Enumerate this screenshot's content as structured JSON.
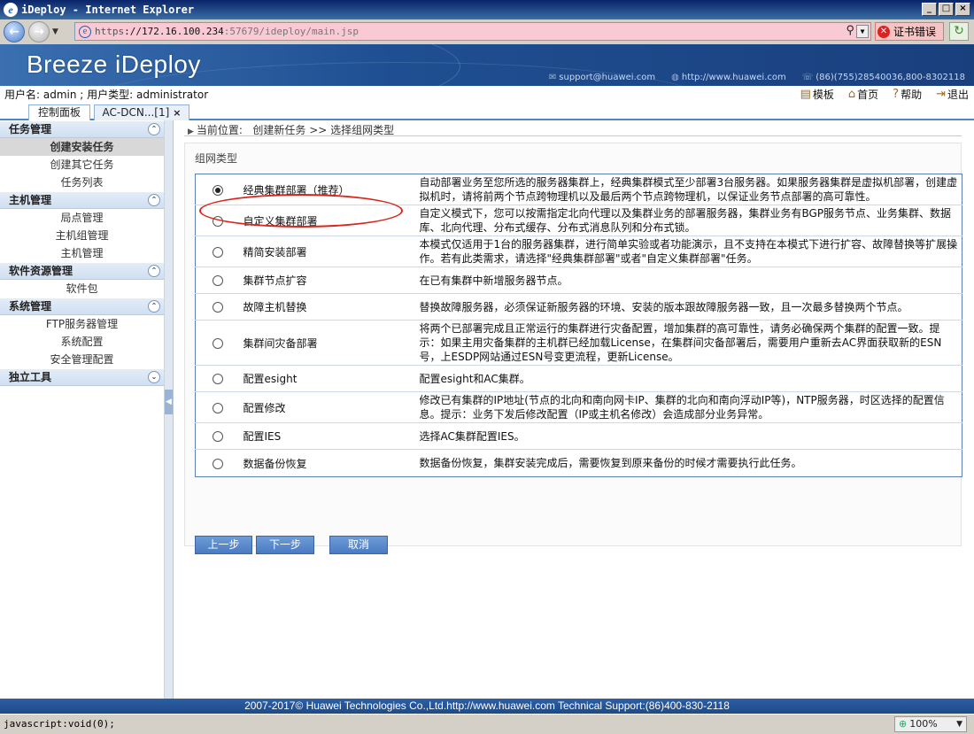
{
  "window": {
    "title": "iDeploy - Internet Explorer",
    "buttons": {
      "minimize": "_",
      "maximize": "□",
      "close": "×"
    }
  },
  "browser": {
    "url_scheme": "https",
    "url_host": "://172.16.100.234",
    "url_rest": ":57679/ideploy/main.jsp",
    "cert_error": "证书错误",
    "zoom": "100%",
    "status": "javascript:void(0);"
  },
  "banner": {
    "title": "Breeze iDeploy",
    "support": "support@huawei.com",
    "website": "http://www.huawei.com",
    "phone": "(86)(755)28540036,800-8302118"
  },
  "userbar": {
    "text": "用户名:  admin ;  用户类型:  administrator",
    "links": {
      "template": "模板",
      "home": "首页",
      "help": "帮助",
      "logout": "退出"
    }
  },
  "tabs": [
    {
      "label": "控制面板"
    },
    {
      "label": "AC-DCN...[1]"
    }
  ],
  "sidebar": {
    "sections": [
      {
        "title": "任务管理",
        "items": [
          "创建安装任务",
          "创建其它任务",
          "任务列表"
        ]
      },
      {
        "title": "主机管理",
        "items": [
          "局点管理",
          "主机组管理",
          "主机管理"
        ]
      },
      {
        "title": "软件资源管理",
        "items": [
          "软件包"
        ]
      },
      {
        "title": "系统管理",
        "items": [
          "FTP服务器管理",
          "系统配置",
          "安全管理配置"
        ]
      },
      {
        "title": "独立工具",
        "items": []
      }
    ],
    "active_item": "创建安装任务"
  },
  "main": {
    "breadcrumb_label": "当前位置:",
    "breadcrumb_path": "创建新任务 >> 选择组网类型",
    "panel_title": "组网类型",
    "options": [
      {
        "name": "经典集群部署（推荐）",
        "desc": "自动部署业务至您所选的服务器集群上，经典集群模式至少部署3台服务器。如果服务器集群是虚拟机部署，创建虚拟机时，请将前两个节点跨物理机以及最后两个节点跨物理机，以保证业务节点部署的高可靠性。",
        "selected": true
      },
      {
        "name": "自定义集群部署",
        "desc": "自定义模式下，您可以按需指定北向代理以及集群业务的部署服务器，集群业务有BGP服务节点、业务集群、数据库、北向代理、分布式缓存、分布式消息队列和分布式锁。",
        "selected": false
      },
      {
        "name": "精简安装部署",
        "desc": "本模式仅适用于1台的服务器集群，进行简单实验或者功能演示，且不支持在本模式下进行扩容、故障替换等扩展操作。若有此类需求，请选择\"经典集群部署\"或者\"自定义集群部署\"任务。",
        "selected": false
      },
      {
        "name": "集群节点扩容",
        "desc": "在已有集群中新增服务器节点。",
        "selected": false
      },
      {
        "name": "故障主机替换",
        "desc": "替换故障服务器，必须保证新服务器的环境、安装的版本跟故障服务器一致，且一次最多替换两个节点。",
        "selected": false
      },
      {
        "name": "集群间灾备部署",
        "desc": "将两个已部署完成且正常运行的集群进行灾备配置，增加集群的高可靠性，请务必确保两个集群的配置一致。提示：如果主用灾备集群的主机群已经加载License，在集群间灾备部署后，需要用户重新去AC界面获取新的ESN号，上ESDP网站通过ESN号变更流程，更新License。",
        "selected": false
      },
      {
        "name": "配置esight",
        "desc": "配置esight和AC集群。",
        "selected": false
      },
      {
        "name": "配置修改",
        "desc": "修改已有集群的IP地址(节点的北向和南向网卡IP、集群的北向和南向浮动IP等)，NTP服务器，时区选择的配置信息。提示：业务下发后修改配置（IP或主机名修改）会造成部分业务异常。",
        "selected": false
      },
      {
        "name": "配置IES",
        "desc": "选择AC集群配置IES。",
        "selected": false
      },
      {
        "name": "数据备份恢复",
        "desc": "数据备份恢复，集群安装完成后，需要恢复到原来备份的时候才需要执行此任务。",
        "selected": false
      }
    ],
    "buttons": {
      "prev": "上一步",
      "next": "下一步",
      "cancel": "取消"
    }
  },
  "footer": {
    "text": "2007-2017© Huawei Technologies Co.,Ltd.http://www.huawei.com   Technical Support:(86)400-830-2118"
  },
  "colors": {
    "accent": "#1f4f92",
    "highlight": "#d9261c",
    "button": "#5a8bcd"
  }
}
